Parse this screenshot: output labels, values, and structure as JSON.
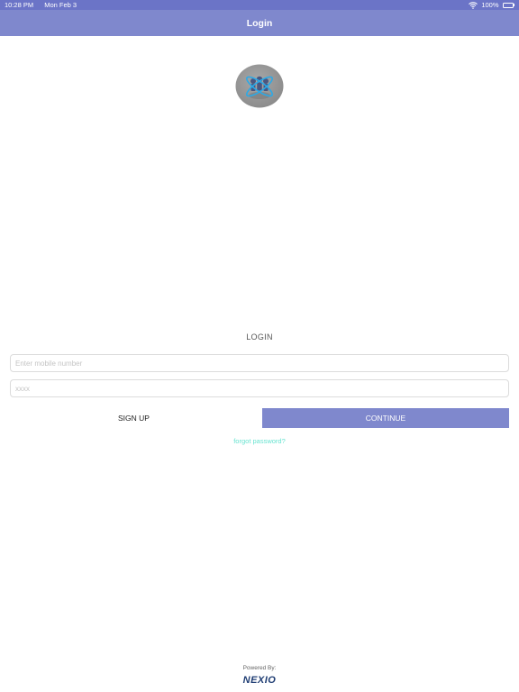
{
  "status_bar": {
    "time": "10:28 PM",
    "date": "Mon Feb 3",
    "battery": "100%",
    "icons": [
      "wifi-icon",
      "battery-icon"
    ]
  },
  "nav": {
    "title": "Login"
  },
  "form": {
    "heading": "LOGIN",
    "mobile_placeholder": "Enter mobile number",
    "password_placeholder": "xxxx",
    "signup_label": "SIGN UP",
    "continue_label": "CONTINUE",
    "forgot_label": "forgot password?"
  },
  "footer": {
    "powered_by": "Powered By:",
    "brand": "NEXIO"
  },
  "colors": {
    "status_bar": "#6b74c7",
    "nav_bar": "#7f88cd",
    "continue_button": "#7f88cd",
    "forgot_link": "#67e3d0",
    "brand": "#1f3d73"
  }
}
